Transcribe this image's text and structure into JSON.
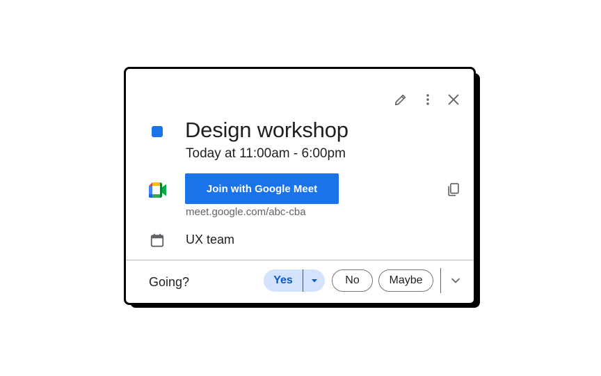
{
  "colors": {
    "event_color": "#1a73e8",
    "join_button": "#1a73e8",
    "yes_bg": "#d3e3fd",
    "yes_text": "#0b57d0",
    "icon_gray": "#5f6368"
  },
  "toolbar": {
    "icons": [
      "pencil-icon",
      "more-vert-icon",
      "close-icon"
    ]
  },
  "event": {
    "title": "Design workshop",
    "time": "Today at 11:00am - 6:00pm"
  },
  "meet": {
    "logo_icon": "google-meet-icon",
    "join_label": "Join with Google Meet",
    "link": "meet.google.com/abc-cba",
    "copy_icon": "copy-icon"
  },
  "calendar": {
    "icon": "calendar-icon",
    "name": "UX team"
  },
  "rsvp": {
    "label": "Going?",
    "yes": "Yes",
    "no": "No",
    "maybe": "Maybe",
    "selected": "Yes"
  }
}
